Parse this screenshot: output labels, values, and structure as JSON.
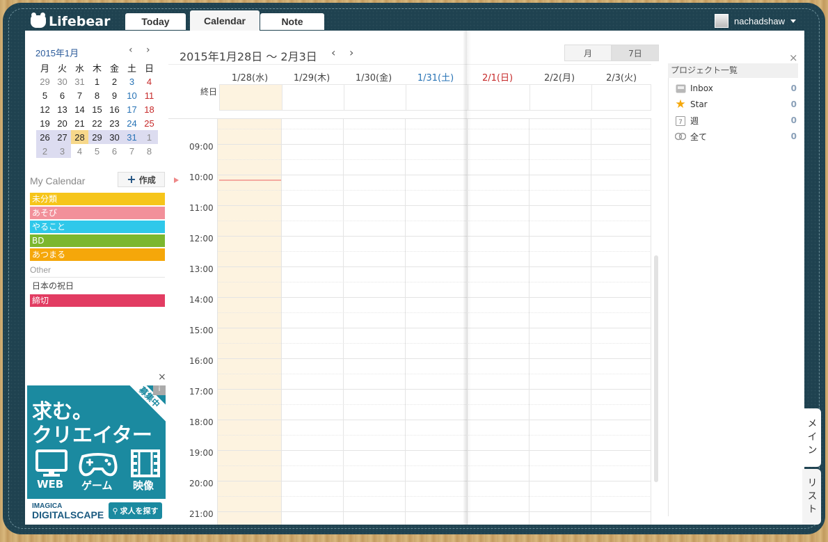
{
  "app": {
    "logo": "Lifebear",
    "tabs": [
      "Today",
      "Calendar",
      "Note"
    ],
    "username": "nachadshaw"
  },
  "mini_calendar": {
    "title": "2015年1月",
    "prev": "‹",
    "next": "›",
    "weekdays": [
      "月",
      "火",
      "水",
      "木",
      "金",
      "土",
      "日"
    ],
    "weeks": [
      [
        "29",
        "30",
        "31",
        "1",
        "2",
        "3",
        "4"
      ],
      [
        "5",
        "6",
        "7",
        "8",
        "9",
        "10",
        "11"
      ],
      [
        "12",
        "13",
        "14",
        "15",
        "16",
        "17",
        "18"
      ],
      [
        "19",
        "20",
        "21",
        "22",
        "23",
        "24",
        "25"
      ],
      [
        "26",
        "27",
        "28",
        "29",
        "30",
        "31",
        "1"
      ],
      [
        "2",
        "3",
        "4",
        "5",
        "6",
        "7",
        "8"
      ]
    ],
    "today": "28"
  },
  "my_calendar": {
    "title": "My Calendar",
    "create_label": "作成",
    "items": [
      {
        "label": "未分類",
        "color": "#f6c51a"
      },
      {
        "label": "あそび",
        "color": "#f2909a"
      },
      {
        "label": "やること",
        "color": "#2fc8ea"
      },
      {
        "label": "BD",
        "color": "#7cb72e"
      },
      {
        "label": "あつまる",
        "color": "#f5a70a"
      }
    ],
    "other_title": "Other",
    "other_items": [
      {
        "label": "日本の祝日",
        "color": ""
      },
      {
        "label": "締切",
        "color": "#e23c62"
      }
    ]
  },
  "ad": {
    "line1": "求む。",
    "line2": "クリエイター",
    "badge": "募集中",
    "info": "i",
    "categories": [
      "WEB",
      "ゲーム",
      "映像"
    ],
    "brand_top": "IMAGICA",
    "brand_bottom": "DIGITALSCAPE",
    "button": "求人を探す",
    "close": "×"
  },
  "main_calendar": {
    "range_title": "2015年1月28日 〜 2月3日",
    "prev": "‹",
    "next": "›",
    "views": [
      "月",
      "7日"
    ],
    "active_view": "7日",
    "days": [
      {
        "label": "1/28(水)",
        "type": "weekday"
      },
      {
        "label": "1/29(木)",
        "type": "weekday"
      },
      {
        "label": "1/30(金)",
        "type": "weekday"
      },
      {
        "label": "1/31(土)",
        "type": "sat"
      },
      {
        "label": "2/1(日)",
        "type": "sun"
      },
      {
        "label": "2/2(月)",
        "type": "weekday"
      },
      {
        "label": "2/3(火)",
        "type": "weekday"
      }
    ],
    "allday_label": "終日",
    "hours": [
      "09:00",
      "10:00",
      "11:00",
      "12:00",
      "13:00",
      "14:00",
      "15:00",
      "16:00",
      "17:00",
      "18:00",
      "19:00",
      "20:00",
      "21:00"
    ]
  },
  "projects": {
    "title": "プロジェクト一覧",
    "close": "×",
    "items": [
      {
        "label": "Inbox",
        "count": "0",
        "icon": "inbox-icon"
      },
      {
        "label": "Star",
        "count": "0",
        "icon": "star-icon"
      },
      {
        "label": "週",
        "count": "0",
        "icon": "calendar-week-icon"
      },
      {
        "label": "全て",
        "count": "0",
        "icon": "all-icon"
      }
    ]
  },
  "side_tabs": [
    "メイン",
    "リスト"
  ]
}
